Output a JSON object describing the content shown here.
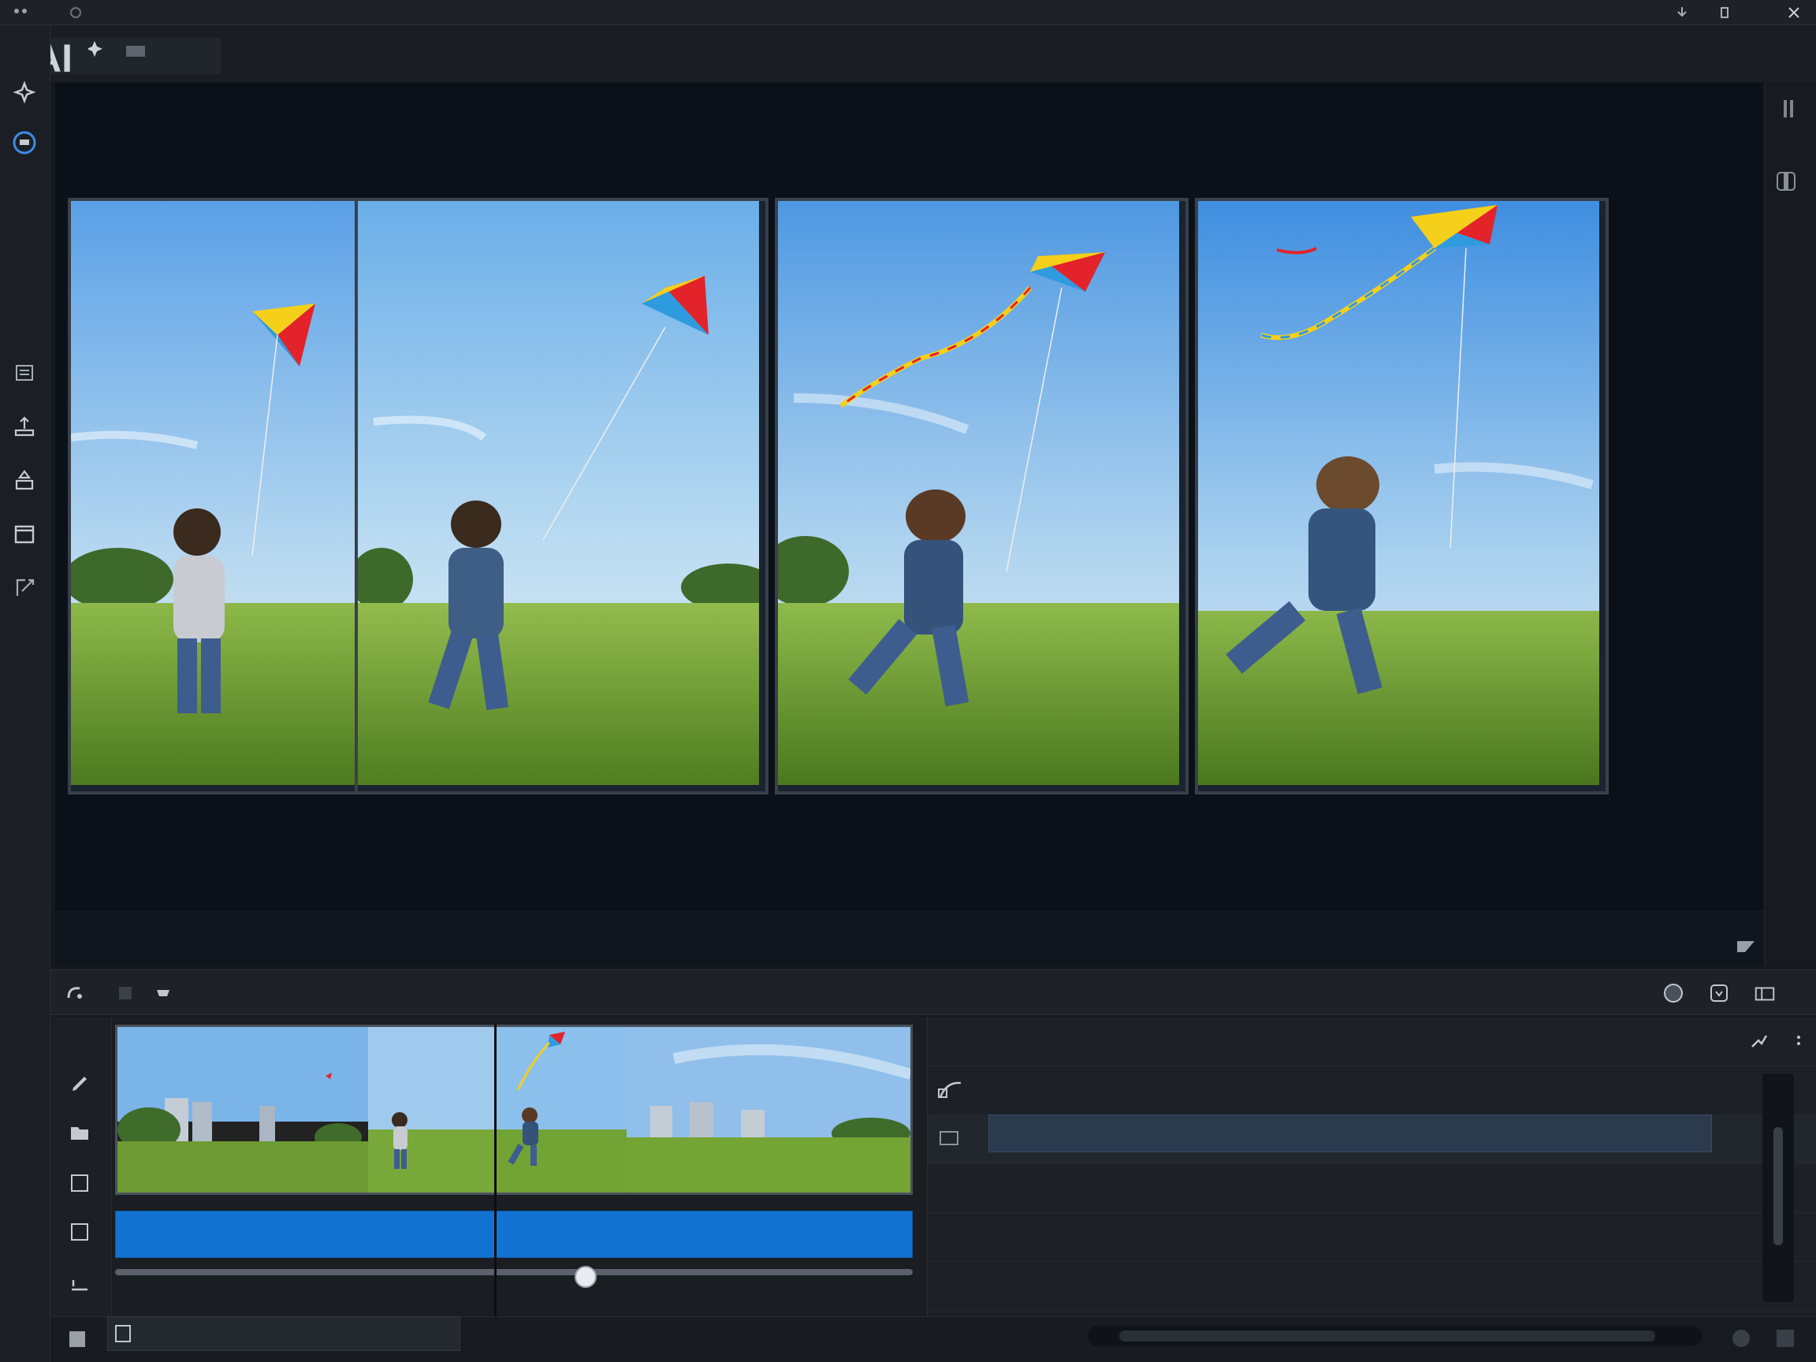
{
  "app": {
    "logo_text": "AI"
  },
  "viewer": {
    "frames": [
      {
        "id": 1,
        "subject": "child-holding-kite-string"
      },
      {
        "id": 2,
        "subject": "child-walking-with-kite"
      },
      {
        "id": 3,
        "subject": "child-running-kite-rising"
      },
      {
        "id": 4,
        "subject": "child-running-kite-high"
      }
    ]
  },
  "timeline": {
    "clips": [
      {
        "id": 1,
        "subject": "city-skyline-field"
      },
      {
        "id": 2,
        "subject": "child-in-field"
      },
      {
        "id": 3,
        "subject": "child-running-kite"
      },
      {
        "id": 4,
        "subject": "city-buildings-field"
      }
    ],
    "playhead_fraction": 0.475,
    "scrub_fraction": 0.59
  },
  "colors": {
    "accent": "#1273d2",
    "viewer_bg": "#0b1119",
    "panel_bg": "#1d2127"
  },
  "icons": {
    "rail": [
      "sparkle-icon",
      "chat-icon",
      "layers-icon",
      "upload-icon",
      "export-icon",
      "frame-icon",
      "resize-icon"
    ],
    "toolbar": [
      "undo-icon",
      "stop-icon",
      "cloud-icon",
      "record-icon",
      "file-icon",
      "split-view-icon"
    ],
    "gutter": [
      "pen-icon",
      "folder-icon",
      "square-icon",
      "square-icon",
      "baseline-icon",
      "square-icon"
    ]
  }
}
